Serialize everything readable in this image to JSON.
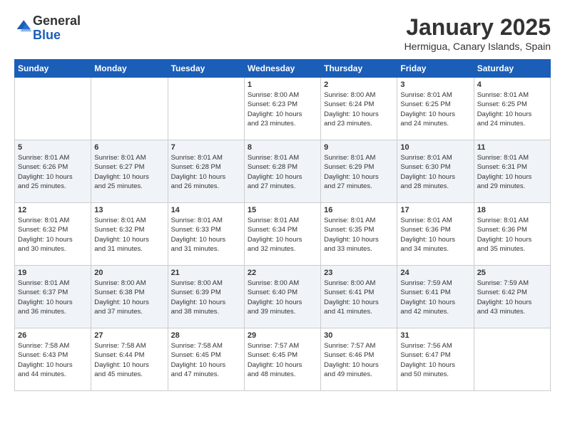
{
  "header": {
    "logo_line1": "General",
    "logo_line2": "Blue",
    "month": "January 2025",
    "location": "Hermigua, Canary Islands, Spain"
  },
  "weekdays": [
    "Sunday",
    "Monday",
    "Tuesday",
    "Wednesday",
    "Thursday",
    "Friday",
    "Saturday"
  ],
  "weeks": [
    [
      {
        "day": "",
        "info": ""
      },
      {
        "day": "",
        "info": ""
      },
      {
        "day": "",
        "info": ""
      },
      {
        "day": "1",
        "info": "Sunrise: 8:00 AM\nSunset: 6:23 PM\nDaylight: 10 hours\nand 23 minutes."
      },
      {
        "day": "2",
        "info": "Sunrise: 8:00 AM\nSunset: 6:24 PM\nDaylight: 10 hours\nand 23 minutes."
      },
      {
        "day": "3",
        "info": "Sunrise: 8:01 AM\nSunset: 6:25 PM\nDaylight: 10 hours\nand 24 minutes."
      },
      {
        "day": "4",
        "info": "Sunrise: 8:01 AM\nSunset: 6:25 PM\nDaylight: 10 hours\nand 24 minutes."
      }
    ],
    [
      {
        "day": "5",
        "info": "Sunrise: 8:01 AM\nSunset: 6:26 PM\nDaylight: 10 hours\nand 25 minutes."
      },
      {
        "day": "6",
        "info": "Sunrise: 8:01 AM\nSunset: 6:27 PM\nDaylight: 10 hours\nand 25 minutes."
      },
      {
        "day": "7",
        "info": "Sunrise: 8:01 AM\nSunset: 6:28 PM\nDaylight: 10 hours\nand 26 minutes."
      },
      {
        "day": "8",
        "info": "Sunrise: 8:01 AM\nSunset: 6:28 PM\nDaylight: 10 hours\nand 27 minutes."
      },
      {
        "day": "9",
        "info": "Sunrise: 8:01 AM\nSunset: 6:29 PM\nDaylight: 10 hours\nand 27 minutes."
      },
      {
        "day": "10",
        "info": "Sunrise: 8:01 AM\nSunset: 6:30 PM\nDaylight: 10 hours\nand 28 minutes."
      },
      {
        "day": "11",
        "info": "Sunrise: 8:01 AM\nSunset: 6:31 PM\nDaylight: 10 hours\nand 29 minutes."
      }
    ],
    [
      {
        "day": "12",
        "info": "Sunrise: 8:01 AM\nSunset: 6:32 PM\nDaylight: 10 hours\nand 30 minutes."
      },
      {
        "day": "13",
        "info": "Sunrise: 8:01 AM\nSunset: 6:32 PM\nDaylight: 10 hours\nand 31 minutes."
      },
      {
        "day": "14",
        "info": "Sunrise: 8:01 AM\nSunset: 6:33 PM\nDaylight: 10 hours\nand 31 minutes."
      },
      {
        "day": "15",
        "info": "Sunrise: 8:01 AM\nSunset: 6:34 PM\nDaylight: 10 hours\nand 32 minutes."
      },
      {
        "day": "16",
        "info": "Sunrise: 8:01 AM\nSunset: 6:35 PM\nDaylight: 10 hours\nand 33 minutes."
      },
      {
        "day": "17",
        "info": "Sunrise: 8:01 AM\nSunset: 6:36 PM\nDaylight: 10 hours\nand 34 minutes."
      },
      {
        "day": "18",
        "info": "Sunrise: 8:01 AM\nSunset: 6:36 PM\nDaylight: 10 hours\nand 35 minutes."
      }
    ],
    [
      {
        "day": "19",
        "info": "Sunrise: 8:01 AM\nSunset: 6:37 PM\nDaylight: 10 hours\nand 36 minutes."
      },
      {
        "day": "20",
        "info": "Sunrise: 8:00 AM\nSunset: 6:38 PM\nDaylight: 10 hours\nand 37 minutes."
      },
      {
        "day": "21",
        "info": "Sunrise: 8:00 AM\nSunset: 6:39 PM\nDaylight: 10 hours\nand 38 minutes."
      },
      {
        "day": "22",
        "info": "Sunrise: 8:00 AM\nSunset: 6:40 PM\nDaylight: 10 hours\nand 39 minutes."
      },
      {
        "day": "23",
        "info": "Sunrise: 8:00 AM\nSunset: 6:41 PM\nDaylight: 10 hours\nand 41 minutes."
      },
      {
        "day": "24",
        "info": "Sunrise: 7:59 AM\nSunset: 6:41 PM\nDaylight: 10 hours\nand 42 minutes."
      },
      {
        "day": "25",
        "info": "Sunrise: 7:59 AM\nSunset: 6:42 PM\nDaylight: 10 hours\nand 43 minutes."
      }
    ],
    [
      {
        "day": "26",
        "info": "Sunrise: 7:58 AM\nSunset: 6:43 PM\nDaylight: 10 hours\nand 44 minutes."
      },
      {
        "day": "27",
        "info": "Sunrise: 7:58 AM\nSunset: 6:44 PM\nDaylight: 10 hours\nand 45 minutes."
      },
      {
        "day": "28",
        "info": "Sunrise: 7:58 AM\nSunset: 6:45 PM\nDaylight: 10 hours\nand 47 minutes."
      },
      {
        "day": "29",
        "info": "Sunrise: 7:57 AM\nSunset: 6:45 PM\nDaylight: 10 hours\nand 48 minutes."
      },
      {
        "day": "30",
        "info": "Sunrise: 7:57 AM\nSunset: 6:46 PM\nDaylight: 10 hours\nand 49 minutes."
      },
      {
        "day": "31",
        "info": "Sunrise: 7:56 AM\nSunset: 6:47 PM\nDaylight: 10 hours\nand 50 minutes."
      },
      {
        "day": "",
        "info": ""
      }
    ]
  ]
}
